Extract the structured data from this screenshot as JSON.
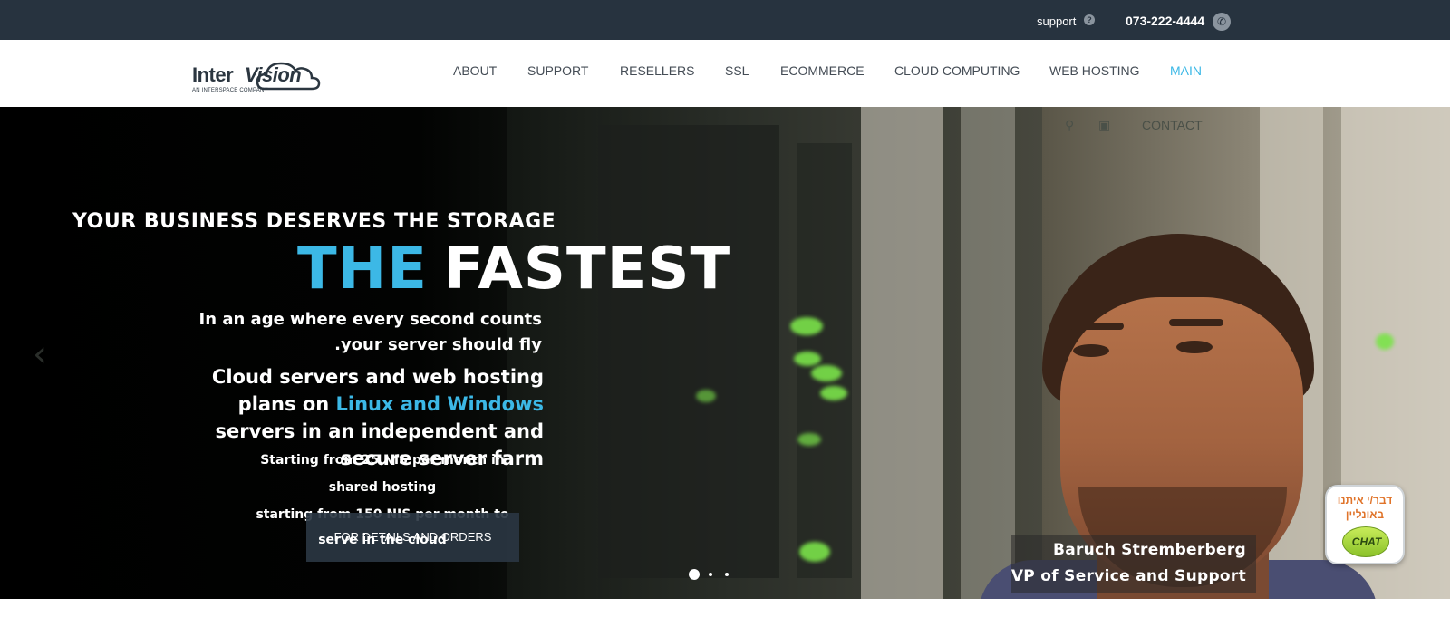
{
  "topbar": {
    "support_label": "support",
    "support_icon": "question-circle-icon",
    "phone": "073-222-4444",
    "phone_icon": "phone-icon"
  },
  "logo": {
    "part1": "Inter",
    "part2": "Vision",
    "tagline": "AN INTERSPACE COMPANY"
  },
  "nav": {
    "items": [
      "ABOUT",
      "SUPPORT",
      "RESELLERS",
      "SSL",
      "ECOMMERCE",
      "CLOUD COMPUTING",
      "WEB HOSTING",
      "MAIN"
    ],
    "active": "MAIN"
  },
  "hero": {
    "contact_label": "CONTACT",
    "icons": [
      "search-icon",
      "cart-icon"
    ],
    "line_deserves": "YOUR BUSINESS DESERVES THE STORAGE",
    "line_the": "THE",
    "line_fastest": "FASTEST",
    "line_age1": "In an age where every second counts",
    "line_age2": ".your server should fly",
    "line_cloud1": "Cloud servers and web hosting",
    "line_cloud2a": "plans on ",
    "line_cloud2b": "Linux and Windows",
    "line_cloud3": "servers in an independent and",
    "line_cloud4": "secure server farm",
    "small1": "Starting from 25 NIS per month in",
    "small2": "shared hosting",
    "small3": "starting from 150 NIS per month to",
    "small4": "serve in the cloud",
    "cta_label": "FOR DETAILS AND ORDERS",
    "caption_name": "Baruch Stremberberg",
    "caption_role": "VP of Service and Support",
    "slide_count": 3,
    "active_slide": 1
  },
  "chat": {
    "line1": "דבר/י איתנו",
    "line2": "באונליין",
    "bubble": "CHAT"
  },
  "colors": {
    "topbar_bg": "#27333f",
    "accent": "#3cb8e6",
    "nav_text": "#444c55",
    "cta_bg": "#2a3642",
    "chat_orange": "#e0742a",
    "chat_green": "#8bc22a"
  }
}
